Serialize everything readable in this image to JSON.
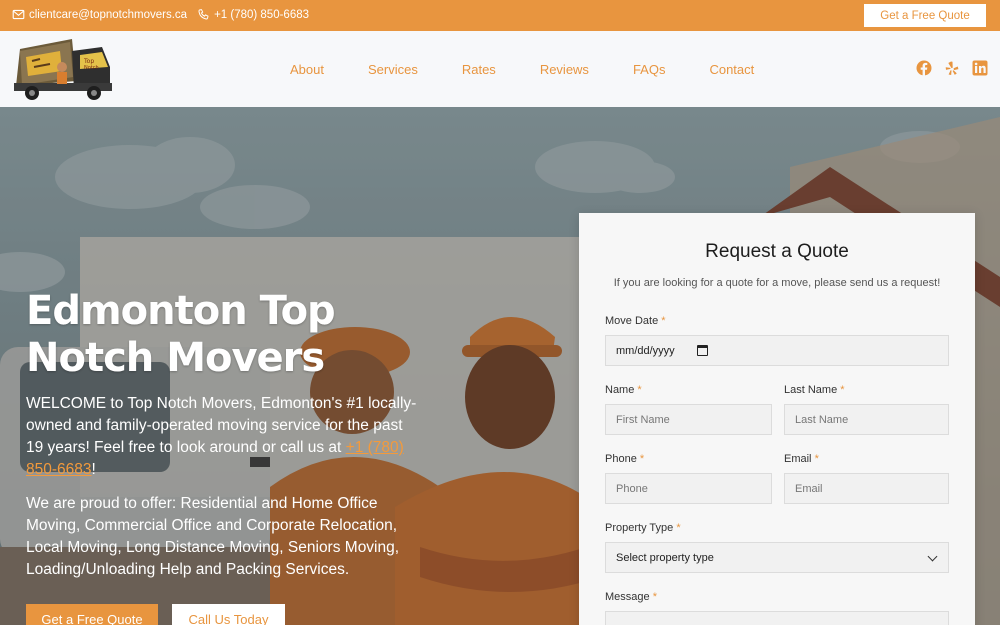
{
  "topbar": {
    "email": "clientcare@topnotchmovers.ca",
    "phone": "+1 (780) 850-6683",
    "quote_button": "Get a Free Quote",
    "email_icon": "mail-icon",
    "phone_icon": "phone-icon"
  },
  "header": {
    "logo_name": "logo-truck",
    "nav": [
      "About",
      "Services",
      "Rates",
      "Reviews",
      "FAQs",
      "Contact"
    ],
    "social_icons": [
      "facebook-icon",
      "yelp-icon",
      "linkedin-icon"
    ]
  },
  "hero": {
    "title": "Edmonton Top Notch Movers",
    "intro_before": "WELCOME to Top Notch Movers, Edmonton's #1 locally-owned and family-operated moving service for the past 19 years! Feel free to look around or call us at ",
    "intro_phone": "+1 (780) 850-6683",
    "intro_after": "!",
    "offer": "We are proud to offer: Residential and Home Office Moving, Commercial Office and Corporate Relocation, Local Moving, Long Distance Moving, Seniors Moving, Loading/Unloading Help and Packing Services.",
    "button_quote": "Get a Free Quote",
    "button_call": "Call Us Today"
  },
  "form": {
    "title": "Request a Quote",
    "subtitle": "If you are looking for a quote for a move, please send us a request!",
    "required_mark": "*",
    "move_date_label": "Move Date",
    "move_date_value": "mm/dd/yyyy",
    "name_label": "Name",
    "first_name_placeholder": "First Name",
    "last_name_label": "Last Name",
    "last_name_placeholder": "Last Name",
    "phone_label": "Phone",
    "phone_placeholder": "Phone",
    "email_label": "Email",
    "email_placeholder": "Email",
    "property_label": "Property Type",
    "property_value": "Select property type",
    "message_label": "Message"
  },
  "colors": {
    "accent": "#e8953f",
    "topbar_bg": "#e8953f",
    "header_bg": "#f7f8fa",
    "form_bg": "#f7f7f7"
  }
}
